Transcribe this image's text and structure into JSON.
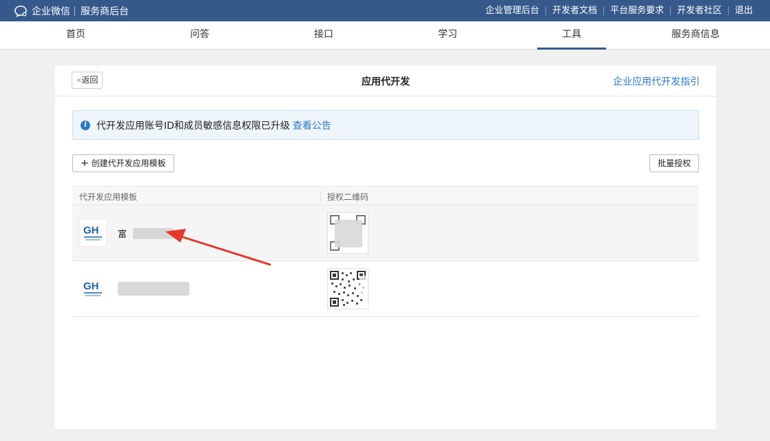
{
  "topbar": {
    "brand": "企业微信",
    "subtitle": "服务商后台",
    "links": [
      "企业管理后台",
      "开发者文档",
      "平台服务要求",
      "开发者社区",
      "退出"
    ]
  },
  "nav": {
    "tabs": [
      "首页",
      "问答",
      "接口",
      "学习",
      "工具",
      "服务商信息"
    ],
    "active": "工具"
  },
  "page": {
    "back_label": "返回",
    "title": "应用代开发",
    "guide_link": "企业应用代开发指引"
  },
  "notice": {
    "text": "代开发应用账号ID和成员敏感信息权限已升级",
    "link": "查看公告"
  },
  "actions": {
    "create": "创建代开发应用模板",
    "batch": "批量授权"
  },
  "table": {
    "headers": [
      "代开发应用模板",
      "授权二维码"
    ],
    "rows": [
      {
        "name": "富"
      },
      {
        "name": ""
      }
    ]
  },
  "colors": {
    "topbar": "#35598b",
    "accent": "#2b79c8",
    "annotation_arrow": "#e8362c"
  },
  "icons": [
    "chat-bubble-icon",
    "double-chevron-left-icon",
    "info-icon",
    "plus-icon",
    "qr-code-icon",
    "logo-icon",
    "red-arrow-annotation"
  ]
}
